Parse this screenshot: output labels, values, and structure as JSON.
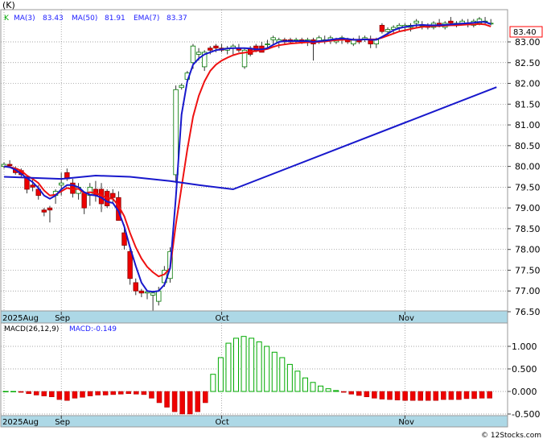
{
  "header": {
    "symbol": "(K)",
    "legend": [
      {
        "label": "K",
        "color": "#00aa00"
      },
      {
        "label": "MA(3)",
        "value": "83.43",
        "color": "#2020ff"
      },
      {
        "label": "MA(50)",
        "value": "81.91",
        "color": "#2020ff"
      },
      {
        "label": "EMA(7)",
        "value": "83.37",
        "color": "#2020ff"
      }
    ],
    "last_price": "83.40"
  },
  "colors": {
    "up_candle": "#ffffff",
    "up_border": "#007700",
    "down_candle": "#ee0000",
    "ema": "#ee1111",
    "ma": "#1818cc",
    "axis_band": "#add8e6",
    "macd_up": "#00aa00",
    "macd_down": "#ee0000"
  },
  "watermark": "© 12Stocks.com",
  "chart_data": [
    {
      "type": "candlestick",
      "title": "",
      "ylim": [
        76.3,
        83.9
      ],
      "y_ticks": [
        "83.00",
        "82.50",
        "82.00",
        "81.50",
        "81.00",
        "80.50",
        "80.00",
        "79.50",
        "79.00",
        "78.50",
        "78.00",
        "77.50",
        "77.00",
        "76.50"
      ],
      "x_tick_labels": [
        "2025Aug",
        "Sep",
        "Oct",
        "Nov"
      ],
      "x_tick_index": [
        0,
        10,
        38,
        70
      ],
      "candles": [
        [
          80.0,
          80.1,
          79.95,
          80.05
        ],
        [
          80.05,
          80.15,
          79.98,
          80.02
        ],
        [
          79.95,
          80.0,
          79.8,
          79.85
        ],
        [
          79.9,
          79.95,
          79.75,
          79.8
        ],
        [
          79.75,
          79.8,
          79.35,
          79.45
        ],
        [
          79.55,
          79.7,
          79.4,
          79.5
        ],
        [
          79.45,
          79.55,
          79.2,
          79.3
        ],
        [
          78.95,
          79.0,
          78.8,
          78.9
        ],
        [
          79.0,
          79.05,
          78.65,
          78.95
        ],
        [
          79.3,
          79.45,
          79.1,
          79.4
        ],
        [
          79.55,
          79.85,
          79.3,
          79.6
        ],
        [
          79.85,
          79.95,
          79.65,
          79.7
        ],
        [
          79.6,
          79.7,
          79.25,
          79.35
        ],
        [
          79.35,
          79.6,
          79.2,
          79.5
        ],
        [
          79.35,
          79.4,
          78.85,
          79.0
        ],
        [
          79.3,
          79.6,
          79.05,
          79.5
        ],
        [
          79.45,
          79.65,
          79.15,
          79.3
        ],
        [
          79.45,
          79.6,
          78.9,
          79.1
        ],
        [
          79.4,
          79.45,
          79.0,
          79.05
        ],
        [
          79.35,
          79.45,
          79.1,
          79.25
        ],
        [
          79.25,
          79.4,
          78.7,
          78.7
        ],
        [
          78.4,
          78.6,
          78.0,
          78.1
        ],
        [
          77.95,
          78.0,
          77.15,
          77.3
        ],
        [
          77.2,
          77.3,
          76.9,
          77.0
        ],
        [
          77.0,
          77.05,
          76.85,
          76.95
        ],
        [
          76.95,
          77.0,
          76.8,
          76.98
        ],
        [
          76.9,
          77.0,
          76.5,
          76.95
        ],
        [
          76.75,
          77.1,
          76.65,
          77.0
        ],
        [
          77.2,
          77.6,
          77.1,
          77.5
        ],
        [
          77.3,
          78.05,
          77.2,
          77.95
        ],
        [
          79.8,
          81.95,
          79.6,
          81.85
        ],
        [
          81.9,
          82.0,
          81.85,
          81.95
        ],
        [
          82.1,
          82.3,
          82.0,
          82.25
        ],
        [
          82.5,
          82.95,
          82.35,
          82.9
        ],
        [
          82.7,
          82.85,
          82.55,
          82.75
        ],
        [
          82.4,
          82.8,
          82.3,
          82.75
        ],
        [
          82.85,
          82.9,
          82.7,
          82.8
        ],
        [
          82.9,
          82.95,
          82.75,
          82.85
        ],
        [
          82.85,
          82.95,
          82.75,
          82.8
        ],
        [
          82.8,
          82.9,
          82.7,
          82.85
        ],
        [
          82.85,
          82.95,
          82.7,
          82.9
        ],
        [
          82.85,
          82.95,
          82.75,
          82.8
        ],
        [
          82.4,
          82.85,
          82.35,
          82.8
        ],
        [
          82.85,
          82.9,
          82.65,
          82.7
        ],
        [
          82.9,
          82.95,
          82.75,
          82.8
        ],
        [
          82.9,
          83.0,
          82.75,
          82.75
        ],
        [
          82.95,
          83.05,
          82.85,
          82.95
        ],
        [
          83.05,
          83.15,
          82.95,
          83.1
        ],
        [
          83.0,
          83.1,
          82.85,
          83.05
        ],
        [
          83.05,
          83.1,
          82.95,
          83.0
        ],
        [
          83.05,
          83.1,
          82.95,
          83.0
        ],
        [
          83.05,
          83.1,
          82.95,
          83.05
        ],
        [
          83.05,
          83.1,
          82.95,
          83.0
        ],
        [
          83.0,
          83.1,
          82.9,
          83.05
        ],
        [
          83.05,
          83.1,
          82.55,
          82.95
        ],
        [
          83.0,
          83.15,
          82.95,
          83.1
        ],
        [
          83.05,
          83.15,
          82.95,
          83.05
        ],
        [
          83.05,
          83.15,
          82.95,
          83.1
        ],
        [
          83.0,
          83.1,
          82.95,
          83.05
        ],
        [
          83.05,
          83.15,
          82.95,
          83.1
        ],
        [
          83.05,
          83.1,
          82.95,
          83.0
        ],
        [
          82.95,
          83.1,
          82.9,
          83.05
        ],
        [
          83.05,
          83.15,
          82.95,
          83.0
        ],
        [
          83.05,
          83.15,
          83.0,
          83.1
        ],
        [
          83.05,
          83.15,
          82.85,
          82.95
        ],
        [
          82.95,
          83.1,
          82.85,
          83.05
        ],
        [
          83.4,
          83.45,
          83.2,
          83.25
        ],
        [
          83.25,
          83.35,
          83.15,
          83.3
        ],
        [
          83.3,
          83.4,
          83.2,
          83.35
        ],
        [
          83.35,
          83.45,
          83.25,
          83.4
        ],
        [
          83.35,
          83.45,
          83.25,
          83.4
        ],
        [
          83.35,
          83.45,
          83.25,
          83.4
        ],
        [
          83.45,
          83.55,
          83.35,
          83.5
        ],
        [
          83.4,
          83.5,
          83.3,
          83.4
        ],
        [
          83.4,
          83.45,
          83.3,
          83.35
        ],
        [
          83.35,
          83.5,
          83.3,
          83.45
        ],
        [
          83.45,
          83.55,
          83.35,
          83.4
        ],
        [
          83.35,
          83.5,
          83.3,
          83.45
        ],
        [
          83.5,
          83.6,
          83.4,
          83.45
        ],
        [
          83.4,
          83.5,
          83.35,
          83.45
        ],
        [
          83.45,
          83.55,
          83.4,
          83.5
        ],
        [
          83.45,
          83.55,
          83.35,
          83.45
        ],
        [
          83.4,
          83.55,
          83.35,
          83.5
        ],
        [
          83.45,
          83.6,
          83.4,
          83.55
        ],
        [
          83.5,
          83.6,
          83.4,
          83.5
        ],
        [
          83.45,
          83.55,
          83.4,
          83.45
        ]
      ],
      "series": [
        {
          "name": "MA(3)",
          "values": [
            80.0,
            79.98,
            79.92,
            79.82,
            79.72,
            79.62,
            79.48,
            79.3,
            79.22,
            79.3,
            79.45,
            79.55,
            79.55,
            79.5,
            79.38,
            79.32,
            79.3,
            79.25,
            79.15,
            79.12,
            78.92,
            78.55,
            78.05,
            77.6,
            77.2,
            77.0,
            76.98,
            77.0,
            77.15,
            77.55,
            79.25,
            81.25,
            82.05,
            82.45,
            82.6,
            82.7,
            82.75,
            82.8,
            82.82,
            82.84,
            82.85,
            82.85,
            82.85,
            82.84,
            82.82,
            82.82,
            82.85,
            82.93,
            83.0,
            83.02,
            83.02,
            83.02,
            83.02,
            83.02,
            83.0,
            83.02,
            83.03,
            83.05,
            83.07,
            83.08,
            83.07,
            83.05,
            83.05,
            83.06,
            83.05,
            83.05,
            83.12,
            83.2,
            83.28,
            83.33,
            83.36,
            83.38,
            83.4,
            83.41,
            83.4,
            83.4,
            83.4,
            83.41,
            83.42,
            83.43,
            83.44,
            83.45,
            83.46,
            83.48,
            83.48,
            83.43
          ]
        },
        {
          "name": "EMA(7)",
          "values": [
            80.0,
            79.99,
            79.95,
            79.9,
            79.78,
            79.7,
            79.6,
            79.42,
            79.3,
            79.32,
            79.4,
            79.48,
            79.45,
            79.46,
            79.35,
            79.38,
            79.36,
            79.3,
            79.24,
            79.22,
            79.05,
            78.8,
            78.4,
            78.05,
            77.78,
            77.58,
            77.45,
            77.35,
            77.4,
            77.55,
            78.6,
            79.5,
            80.4,
            81.2,
            81.7,
            82.05,
            82.3,
            82.45,
            82.55,
            82.62,
            82.68,
            82.72,
            82.74,
            82.76,
            82.78,
            82.8,
            82.83,
            82.88,
            82.92,
            82.94,
            82.96,
            82.97,
            82.98,
            82.99,
            82.99,
            83.0,
            83.01,
            83.03,
            83.04,
            83.05,
            83.05,
            83.05,
            83.05,
            83.06,
            83.06,
            83.06,
            83.1,
            83.15,
            83.2,
            83.25,
            83.28,
            83.31,
            83.34,
            83.36,
            83.37,
            83.38,
            83.38,
            83.39,
            83.4,
            83.4,
            83.41,
            83.42,
            83.42,
            83.43,
            83.42,
            83.37
          ]
        },
        {
          "name": "MA(50)",
          "points": [
            [
              0,
              79.75
            ],
            [
              10,
              79.7
            ],
            [
              16,
              79.78
            ],
            [
              22,
              79.75
            ],
            [
              29,
              79.65
            ],
            [
              34,
              79.55
            ],
            [
              40,
              79.45
            ],
            [
              86,
              81.91
            ]
          ]
        }
      ]
    },
    {
      "type": "bar",
      "title": "MACD(26,12,9)",
      "label": "MACD:-0.149",
      "ylim": [
        -0.5,
        1.3
      ],
      "y_ticks": [
        "1.000",
        "0.500",
        "0.000",
        "-0.500"
      ],
      "x_tick_labels": [
        "2025Aug",
        "Sep",
        "Oct",
        "Nov"
      ],
      "values": [
        0.0,
        0.0,
        -0.02,
        -0.05,
        -0.08,
        -0.1,
        -0.12,
        -0.18,
        -0.2,
        -0.15,
        -0.13,
        -0.1,
        -0.08,
        -0.08,
        -0.07,
        -0.06,
        -0.05,
        -0.06,
        -0.07,
        -0.15,
        -0.25,
        -0.35,
        -0.45,
        -0.5,
        -0.5,
        -0.45,
        -0.25,
        0.38,
        0.75,
        1.07,
        1.18,
        1.22,
        1.18,
        1.1,
        1.0,
        0.87,
        0.75,
        0.6,
        0.45,
        0.3,
        0.2,
        0.12,
        0.06,
        0.02,
        -0.02,
        -0.06,
        -0.09,
        -0.12,
        -0.15,
        -0.17,
        -0.18,
        -0.19,
        -0.2,
        -0.2,
        -0.2,
        -0.2,
        -0.2,
        -0.18,
        -0.18,
        -0.18,
        -0.16,
        -0.16,
        -0.15,
        -0.15
      ]
    }
  ]
}
